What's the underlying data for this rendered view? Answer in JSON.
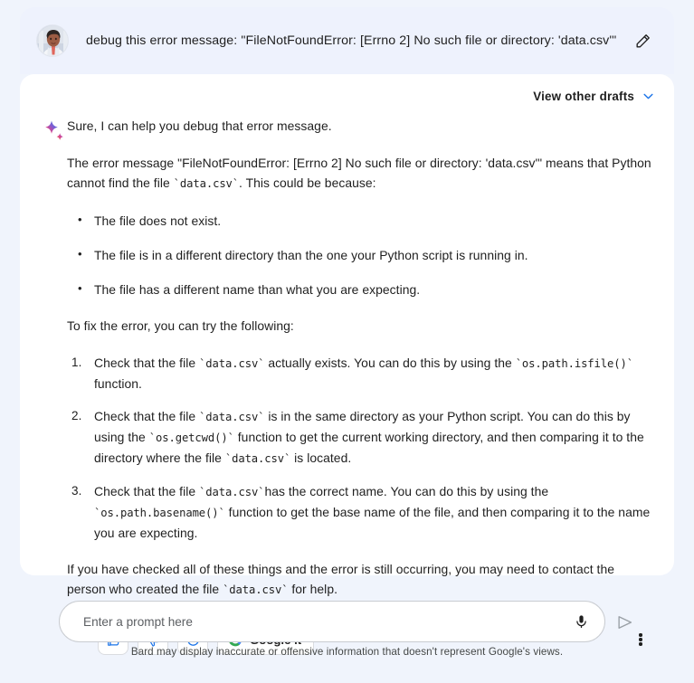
{
  "app": {
    "name": "Bard"
  },
  "prompt": {
    "text": "debug this error message: \"FileNotFoundError: [Errno 2] No such file or directory: 'data.csv'\"",
    "avatar_alt": "user-avatar",
    "edit_icon": "pencil-icon"
  },
  "response": {
    "drafts_label": "View other drafts",
    "drafts_chevron_icon": "chevron-down-icon",
    "bard_icon": "bard-sparkle-icon",
    "intro": "Sure, I can help you debug that error message.",
    "explanation_pre": "The error message \"FileNotFoundError: [Errno 2] No such file or directory: 'data.csv'\" means that Python cannot find the file ",
    "explanation_code": "`data.csv`",
    "explanation_post": ". This could be because:",
    "causes": [
      "The file does not exist.",
      "The file is in a different directory than the one your Python script is running in.",
      "The file has a different name than what you are expecting."
    ],
    "fix_intro": "To fix the error, you can try the following:",
    "steps": [
      {
        "p1": "Check that the file ",
        "c1": "`data.csv`",
        "p2": " actually exists. You can do this by using the ",
        "c2": "`os.path.isfile()`",
        "p3": " function."
      },
      {
        "p1": "Check that the file ",
        "c1": "`data.csv`",
        "p2": " is in the same directory as your Python script. You can do this by using the ",
        "c2": "`os.getcwd()`",
        "p3": " function to get the current working directory, and then comparing it to the directory where the file ",
        "c3": "`data.csv`",
        "p4": " is located."
      },
      {
        "p1": "Check that the file ",
        "c1": "`data.csv`",
        "p2": "has the correct name. You can do this by using the ",
        "c2": "`os.path.basename()`",
        "p3": " function to get the base name of the file, and then comparing it to the name you are expecting."
      }
    ],
    "closing_pre": "If you have checked all of these things and the error is still occurring, you may need to contact the person who created the file ",
    "closing_code": "`data.csv`",
    "closing_post": " for help."
  },
  "actions": {
    "thumbs_up_icon": "thumb-up-icon",
    "thumbs_down_icon": "thumb-down-icon",
    "regenerate_icon": "refresh-icon",
    "google_it_label": "Google it",
    "google_logo_icon": "google-g-icon",
    "more_icon": "more-vertical-icon"
  },
  "composer": {
    "placeholder": "Enter a prompt here",
    "value": "",
    "mic_icon": "microphone-icon",
    "send_icon": "send-icon"
  },
  "disclaimer": "Bard may display inaccurate or offensive information that doesn't represent Google's views.",
  "colors": {
    "page_bg": "#f0f4fc",
    "prompt_bg": "#eef2fd",
    "card_bg": "#ffffff",
    "accent_blue": "#1a73e8",
    "text": "#1f1f1f",
    "border": "#dadce0"
  }
}
